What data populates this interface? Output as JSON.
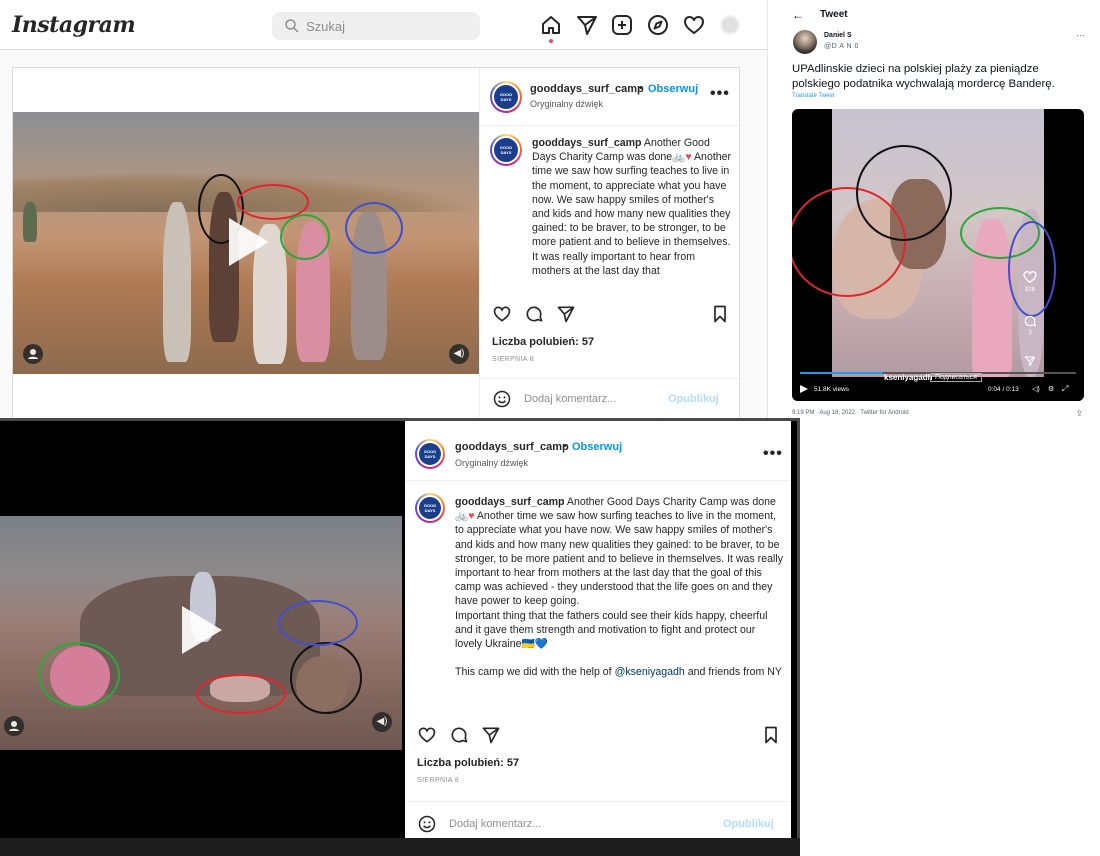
{
  "ig_top": {
    "logo": "Instagram",
    "search_placeholder": "Szukaj",
    "post": {
      "username": "gooddays_surf_camp",
      "separator": "•",
      "follow": "Obserwuj",
      "audio": "Oryginalny dźwięk",
      "more": "•••",
      "avatar_text": "GOOD DAYS",
      "caption_user": "gooddays_surf_camp",
      "caption_text": " Another Good Days Charity Camp was done🚲",
      "caption_heart": "♥",
      "caption_rest": " Another time we saw how surfing teaches to live in the moment, to appreciate what you have now. We saw happy smiles of mother's and kids and how many new qualities they gained: to be braver, to be stronger, to be more patient and to believe in themselves. It was really important to hear from mothers at the last day that",
      "likes": "Liczba polubień: 57",
      "date": "SIERPNIA 8",
      "comment_placeholder": "Dodaj komentarz...",
      "publish": "Opublikuj"
    }
  },
  "tweet": {
    "back": "←",
    "title": "Tweet",
    "author_name": "Daniel S",
    "author_handle": "@D A N 0",
    "more": "···",
    "text": "UPAdlinskie dzieci na polskiej plaży za pieniądze polskiego podatnika wychwalają mordercę Banderę.",
    "translate": "Translate Tweet",
    "views": "51.8K views",
    "overlay_user": "kseniyagadh",
    "overlay_subscribe": "Подписаться",
    "time": "0:04 / 0:13",
    "like_count": "928",
    "comment_count": "3",
    "meta": "9:19 PM · Aug 18, 2022 · Twitter for Android",
    "progress": 0.3
  },
  "ig_bottom": {
    "post": {
      "username": "gooddays_surf_camp",
      "separator": "•",
      "follow": "Obserwuj",
      "audio": "Oryginalny dźwięk",
      "more": "•••",
      "avatar_text": "GOOD DAYS",
      "caption_user": "gooddays_surf_camp",
      "caption_text": " Another Good Days Charity Camp was done🚲",
      "caption_heart": "♥",
      "caption_rest": " Another time we saw how surfing teaches to live in the moment, to appreciate what you have now. We saw happy smiles of mother's and kids and how many new qualities they gained: to be braver, to be stronger, to be more patient and to believe in themselves. It was really important to hear from mothers at the last day that the goal of this camp was achieved - they understood that the life goes on and they have power to keep going.",
      "caption_p2": "Important thing that the fathers could see their kids happy, cheerful and it gave them strength and motivation to fight and protect our lovely Ukraine",
      "caption_p2_end": "🇺🇦💙",
      "caption_p3a": "This camp we did with the help of ",
      "caption_mention": "@kseniyagadh",
      "caption_p3b": " and friends from NY",
      "likes": "Liczba polubień: 57",
      "date": "SIERPNIA 8",
      "comment_placeholder": "Dodaj komentarz...",
      "publish": "Opublikuj"
    }
  },
  "colors": {
    "instagram_link": "#0095f6",
    "publish_disabled": "#b3dbff",
    "annotation_black": "#111111",
    "annotation_red": "#e0262b",
    "annotation_green": "#2ca83a",
    "annotation_blue": "#3f4fd0"
  },
  "icons": [
    "home-icon",
    "direct-icon",
    "new-post-icon",
    "explore-icon",
    "activity-heart-icon",
    "profile-avatar",
    "search-icon",
    "play-icon",
    "user-tag-icon",
    "sound-icon",
    "like-icon",
    "comment-icon",
    "share-icon",
    "bookmark-icon",
    "emoji-icon"
  ]
}
